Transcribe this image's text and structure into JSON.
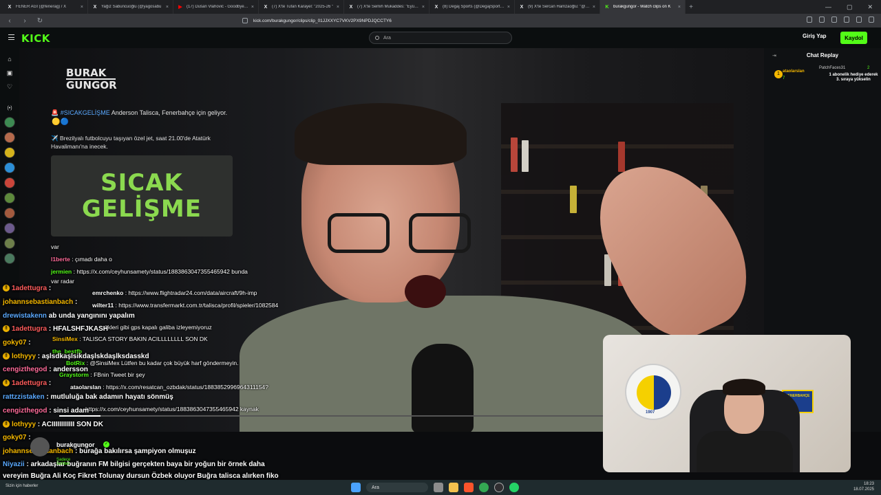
{
  "browser": {
    "tabs": [
      {
        "title": "FENER AĞI (@fenerag) / X",
        "icon": "x-icon",
        "active": false
      },
      {
        "title": "Yağız Sabuncuoğlu (@yagosabu",
        "icon": "x-icon",
        "active": false
      },
      {
        "title": "(17) Dušan Vlahović - Goodbye Juve",
        "icon": "youtube-icon",
        "active": false
      },
      {
        "title": "(7) X'te Tufan Karayel: \"2025-26 \"",
        "icon": "x-icon",
        "active": false
      },
      {
        "title": "(7) X'te Semih Mukaddes: \"Eyüpspo",
        "icon": "x-icon",
        "active": false
      },
      {
        "title": "(8) Degaj Sports (@DegajSportscom",
        "icon": "x-icon",
        "active": false
      },
      {
        "title": "(9) X'te Sercan Hamzaoğlu: \"@Bedir",
        "icon": "x-icon",
        "active": false
      },
      {
        "title": "burakgungor - Watch clips on K",
        "icon": "kick-icon",
        "active": true
      }
    ],
    "url": "kick.com/burakgungor/clips/clip_01JJXXYC7VKV2PX9NPDJQCCTY6"
  },
  "header": {
    "logo": "KICK",
    "search_placeholder": "Ara",
    "login_label": "Giriş Yap",
    "signup_label": "Kaydol"
  },
  "stream": {
    "brand_line1": "BURAK",
    "brand_line2": "GUNGOR",
    "hashtag": "#SICAKGELİŞME",
    "headline": " Anderson Talisca, Fenerbahçe için geliyor.",
    "flight_text": "✈️ Brezilyalı futbolcuyu taşıyan özel jet, saat 21.00'de Atatürk Havalimanı'na inecek.",
    "card_line1": "SICAK",
    "card_line2": "GELİŞME",
    "progress": 0.06
  },
  "video_chat": [
    {
      "user": "",
      "text": "var",
      "user_color": "#fff"
    },
    {
      "user": "l1berte",
      "text": " : çımadı daha o",
      "user_color": "#ff6b9a"
    },
    {
      "user": "jermien",
      "text": " : https://x.com/ceyhunsamety/status/1883863047355465942 bunda",
      "user_color": "#53fc18"
    },
    {
      "user": "",
      "text": "var radar",
      "user_color": "#fff"
    },
    {
      "user": "emrchenko",
      "text": " : https://www.flightradar24.com/data/aircraft/9h-imp",
      "user_color": "#fff"
    },
    {
      "user": "wilter11",
      "text": " : https://www.transfermarkt.com.tr/talisca/profil/spieler/1082584",
      "user_color": "#fff"
    },
    {
      "user": "",
      "text": "dikleri gibi gps kapalı galiba izleyemiyoruz",
      "user_color": "#fff"
    },
    {
      "user": "SinsiMex",
      "text": " : TALISCA STORY BAKIN ACILLLLLLLL SON DK",
      "user_color": "#f5b800"
    },
    {
      "user": "the_bestfb",
      "text": "",
      "user_color": "#53fc18"
    },
    {
      "user": "BotRix",
      "text": " : @SinsiMex Lütfen bu kadar çok büyük harf göndermeyin.",
      "user_color": "#53fc18"
    },
    {
      "user": "Graystorm",
      "text": " : FBnin Tweet bir şey",
      "user_color": "#53fc18"
    },
    {
      "user": "ataolarslan",
      "text": " : https://x.com/resatcan_ozbdak/status/1883852996964311154?",
      "user_color": "#fff"
    },
    {
      "user": "",
      "text": "https://x.com/ceyhunsamety/status/1883863047355465942 kaynak",
      "user_color": "#fff"
    }
  ],
  "overlay_chat": [
    {
      "badge": "!",
      "user": "1adettugra",
      "text": " :",
      "user_color": "#ff5c5c"
    },
    {
      "badge": "",
      "user": "johannsebastianbach",
      "text": " :",
      "user_color": "#f5b800"
    },
    {
      "badge": "",
      "user": "drewistakenn",
      "text": " ab  unda yangınını yapalım",
      "user_color": "#5aa9ff"
    },
    {
      "badge": "!",
      "user": "1adettugra",
      "text": " : HFALSHFJKASH",
      "user_color": "#ff5c5c"
    },
    {
      "badge": "",
      "user": "goky07",
      "text": " :",
      "user_color": "#f5b800"
    },
    {
      "badge": "!",
      "user": "lothyyy",
      "text": " : aşlsdkaşlsikdaşlskdaşlksdasskd",
      "user_color": "#f5b800"
    },
    {
      "badge": "",
      "user": "cengizthegod",
      "text": " : andersson",
      "user_color": "#ff6b9a"
    },
    {
      "badge": "!",
      "user": "1adettugra",
      "text": " :",
      "user_color": "#ff5c5c"
    },
    {
      "badge": "",
      "user": "rattzzistaken",
      "text": " : mutluluğa bak adamın hayatı sönmüş",
      "user_color": "#5aa9ff"
    },
    {
      "badge": "",
      "user": "cengizthegod",
      "text": " : sinsi adam",
      "user_color": "#ff6b9a"
    },
    {
      "badge": "!",
      "user": "lothyyy",
      "text": " : ACIIIIIIIIIIII SON DK",
      "user_color": "#f5b800"
    },
    {
      "badge": "",
      "user": "goky07",
      "text": " :",
      "user_color": "#f5b800"
    },
    {
      "badge": "",
      "user": "johannsebastianbach",
      "text": " : burağa bakılırsa şampiyon olmuşuz",
      "user_color": "#f5b800"
    },
    {
      "badge": "",
      "user": "Niyazii",
      "text": " : arkadaşlar buğranın FM bilgisi gerçekten baya bir yoğun bir örnek daha",
      "user_color": "#5aa9ff"
    },
    {
      "badge": "",
      "user": "",
      "text": "vereyim Buğra Ali Koç Fikret Tolunay dursun Özbek oluyor Buğra talisca alırken fiko",
      "user_color": "#fff"
    },
    {
      "badge": "",
      "user": "",
      "text": "gykereş almış 15 milyon peşin gerisi taksitli şekilde 😂",
      "user_color": "#fff"
    }
  ],
  "clip_author": {
    "name": "burakgungor",
    "sub": "Sadece Sohbet"
  },
  "chat_panel": {
    "title": "Chat Replay",
    "pinned_user": "ataolarslan",
    "pinned_count": "7",
    "gift_user": "PatchFaces31",
    "gift_count": "2",
    "gift_message": "1 abonelik hediye ederek 3. sıraya yükselin"
  },
  "webcam": {
    "crest_year": "1907",
    "sign_text": "FENERBAHÇE"
  },
  "taskbar": {
    "weather": "Sizin için haberler",
    "search": "Ara",
    "time": "18:23",
    "date": "18.07.2025"
  }
}
